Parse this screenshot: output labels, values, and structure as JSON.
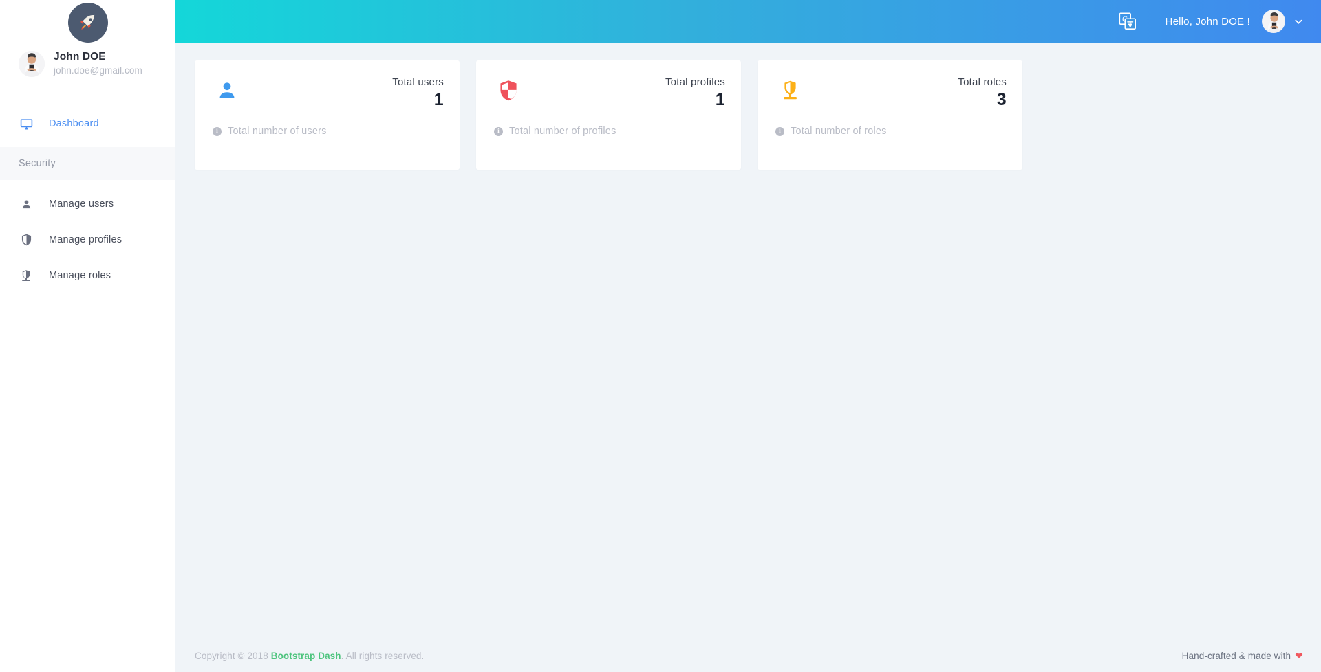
{
  "brand": {
    "logo_icon": "rocket-icon"
  },
  "sidebar": {
    "profile": {
      "name": "John DOE",
      "email": "john.doe@gmail.com",
      "avatar_icon": "user-avatar"
    },
    "nav_top": [
      {
        "label": "Dashboard",
        "icon": "monitor-icon",
        "active": true
      }
    ],
    "section_label": "Security",
    "nav_group": [
      {
        "label": "Manage users",
        "icon": "person-icon"
      },
      {
        "label": "Manage profiles",
        "icon": "shield-icon"
      },
      {
        "label": "Manage roles",
        "icon": "shield-stand-icon"
      }
    ]
  },
  "topbar": {
    "translate_icon": "google-translate-icon",
    "greeting": "Hello, John DOE !",
    "avatar_icon": "user-avatar",
    "caret_icon": "chevron-down-icon",
    "gradient_from": "#14d7d9",
    "gradient_to": "#4089ef"
  },
  "cards": [
    {
      "label": "Total users",
      "value": "1",
      "sub": "Total number of users",
      "icon": "person-filled-icon",
      "color": "#3f9aee"
    },
    {
      "label": "Total profiles",
      "value": "1",
      "sub": "Total number of profiles",
      "icon": "shield-cross-icon",
      "color": "#ef525c"
    },
    {
      "label": "Total roles",
      "value": "3",
      "sub": "Total number of roles",
      "icon": "shield-stand-filled-icon",
      "color": "#fcb017"
    }
  ],
  "footer": {
    "copyright_prefix": "Copyright © 2018 ",
    "link_label": "Bootstrap Dash",
    "copyright_suffix": ". All rights reserved.",
    "credit": "Hand-crafted & made with",
    "heart_icon": "heart-icon",
    "link_color": "#4ec47e",
    "heart_color": "#f0585f"
  }
}
